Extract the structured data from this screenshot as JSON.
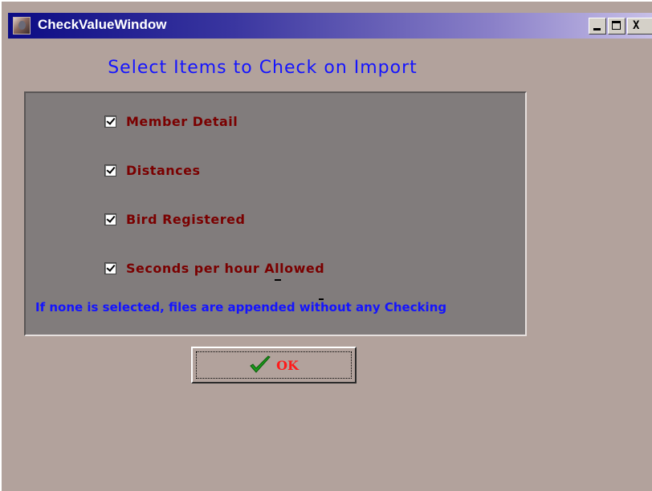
{
  "window": {
    "title": "CheckValueWindow",
    "controls": {
      "minimize": "_",
      "maximize": "□",
      "close": "X"
    },
    "colors": {
      "background": "#b2a29c",
      "panel": "#817c7c",
      "heading": "#1414ff",
      "label": "#7a0000",
      "ok_text": "#ff1a1a"
    }
  },
  "heading": "Select  Items to Check on Import",
  "options": [
    {
      "label": "Member Detail",
      "checked": true
    },
    {
      "label": "Distances",
      "checked": true
    },
    {
      "label": "Bird Registered",
      "checked": true
    },
    {
      "label": "Seconds per hour Allowed",
      "checked": true
    }
  ],
  "note": "If none is selected, files are appended without any Checking",
  "ok_button": {
    "label": "OK",
    "icon": "green-check-icon"
  }
}
